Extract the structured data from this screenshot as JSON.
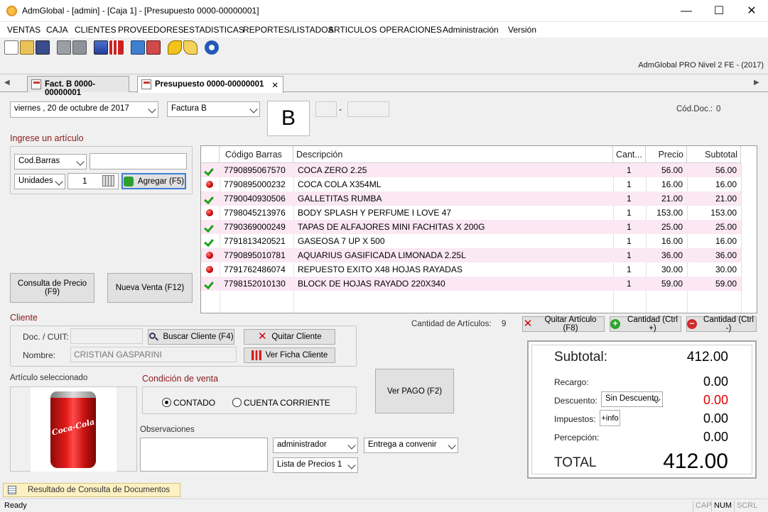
{
  "window": {
    "title": "AdmGlobal - [admin] - [Caja 1] - [Presupuesto 0000-00000001]",
    "minimize": "—",
    "maximize": "☐",
    "close": "✕"
  },
  "menu": [
    "VENTAS",
    "CAJA",
    "CLIENTES",
    "PROVEEDORES",
    "ESTADISTICAS",
    "REPORTES/LISTADOS",
    "ARTICULOS",
    "OPERACIONES",
    "Administración",
    "Versión"
  ],
  "toolbar": {
    "icons": [
      "new-icon",
      "open-icon",
      "save-icon",
      "print-icon",
      "print-preview-icon",
      "user-icon",
      "chart-icon",
      "calendar-icon",
      "calendar2-icon",
      "key-icon",
      "key2-icon",
      "help-icon"
    ]
  },
  "banner": "AdmGlobal PRO Nivel 2 FE - (2017)",
  "tabs": [
    {
      "label": "Fact. B 0000-00000001"
    },
    {
      "label": "Presupuesto 0000-00000001",
      "close": "✕"
    }
  ],
  "header": {
    "date": "viernes  , 20 de   octubre   de 2017",
    "invoice_type": "Factura B",
    "letter": "B",
    "point_of_sale": "",
    "separator": "-",
    "number": "",
    "cod_doc_label": "Cód.Doc.:",
    "cod_doc_value": "0"
  },
  "article_entry": {
    "title": "Ingrese un artículo",
    "search_type": "Cod.Barras",
    "search_value": "",
    "unit_type": "Unidades",
    "quantity": "1",
    "add_label": "Agregar (F5)"
  },
  "left_buttons": {
    "price_query": "Consulta de Precio (F9)",
    "new_sale": "Nueva Venta (F12)"
  },
  "grid": {
    "columns": [
      "Código Barras",
      "Descripción",
      "Cant...",
      "Precio",
      "Subtotal"
    ],
    "rows": [
      {
        "status": "ok",
        "code": "7790895067570",
        "desc": "COCA ZERO 2.25",
        "qty": "1",
        "price": "56.00",
        "subtotal": "56.00"
      },
      {
        "status": "red",
        "code": "7790895000232",
        "desc": "COCA COLA X354ML",
        "qty": "1",
        "price": "16.00",
        "subtotal": "16.00"
      },
      {
        "status": "ok",
        "code": "7790040930506",
        "desc": "GALLETITAS RUMBA",
        "qty": "1",
        "price": "21.00",
        "subtotal": "21.00"
      },
      {
        "status": "red",
        "code": "7798045213976",
        "desc": "BODY SPLASH Y PERFUME  I LOVE 47",
        "qty": "1",
        "price": "153.00",
        "subtotal": "153.00"
      },
      {
        "status": "ok",
        "code": "7790369000249",
        "desc": "TAPAS DE ALFAJORES MINI FACHITAS X 200G",
        "qty": "1",
        "price": "25.00",
        "subtotal": "25.00"
      },
      {
        "status": "ok",
        "code": "7791813420521",
        "desc": "GASEOSA 7 UP X 500",
        "qty": "1",
        "price": "16.00",
        "subtotal": "16.00"
      },
      {
        "status": "red",
        "code": "7790895010781",
        "desc": "AQUARIUS GASIFICADA LIMONADA 2.25L",
        "qty": "1",
        "price": "36.00",
        "subtotal": "36.00"
      },
      {
        "status": "red",
        "code": "7791762486074",
        "desc": "REPUESTO EXITO X48 HOJAS RAYADAS",
        "qty": "1",
        "price": "30.00",
        "subtotal": "30.00"
      },
      {
        "status": "ok",
        "code": "7798152010130",
        "desc": "BLOCK DE HOJAS RAYADO 220X340",
        "qty": "1",
        "price": "59.00",
        "subtotal": "59.00"
      }
    ]
  },
  "grid_footer": {
    "count_label": "Cantidad de Artículos:",
    "count": "9",
    "remove": "Quitar Artículo (F8)",
    "qty_plus": "Cantidad (Ctrl +)",
    "qty_minus": "Cantidad (Ctrl -)"
  },
  "client": {
    "title": "Cliente",
    "doc_label": "Doc. / CUIT:",
    "doc_value": "",
    "search_btn": "Buscar Cliente (F4)",
    "remove_btn": "Quitar Cliente",
    "name_label": "Nombre:",
    "name_value": "CRISTIAN GASPARINI",
    "card_btn": "Ver Ficha Cliente"
  },
  "selected_article": {
    "label": "Artículo seleccionado",
    "brand_text": "Coca-Cola"
  },
  "sale_condition": {
    "title": "Condición de venta",
    "opt1": "CONTADO",
    "opt2": "CUENTA CORRIENTE",
    "selected": "CONTADO"
  },
  "observations": {
    "label": "Observaciones",
    "value": ""
  },
  "selects": {
    "seller": "administrador",
    "delivery": "Entrega a convenir",
    "price_list": "Lista de Precios 1"
  },
  "pay_button": "Ver PAGO (F2)",
  "totals": {
    "subtotal_label": "Subtotal:",
    "subtotal": "412.00",
    "surcharge_label": "Recargo:",
    "surcharge": "0.00",
    "discount_label": "Descuento:",
    "discount_select": "Sin Descuento",
    "discount": "0.00",
    "taxes_label": "Impuestos:",
    "taxes_info": "+info",
    "taxes": "0.00",
    "perception_label": "Percepción:",
    "perception": "0.00",
    "total_label": "TOTAL",
    "total": "412.00"
  },
  "colors": {
    "discount_value": "#e00000",
    "section_title": "#8b1a1a"
  },
  "docs_tab": "Resultado de Consulta de Documentos",
  "status": {
    "text": "Ready",
    "ind": [
      "CAP",
      "NUM",
      "SCRL"
    ]
  }
}
